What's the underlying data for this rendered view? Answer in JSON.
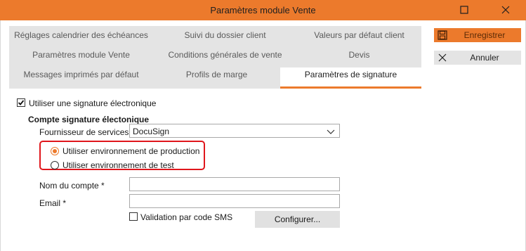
{
  "window": {
    "title": "Paramètres module Vente"
  },
  "tabs": [
    {
      "label": "Réglages calendrier des échéances"
    },
    {
      "label": "Suivi du dossier client"
    },
    {
      "label": "Valeurs par défaut client"
    },
    {
      "label": "Paramètres module Vente"
    },
    {
      "label": "Conditions générales de vente"
    },
    {
      "label": "Devis"
    },
    {
      "label": "Messages imprimés par défaut"
    },
    {
      "label": "Profils de marge"
    },
    {
      "label": "Paramètres de signature",
      "active": true
    }
  ],
  "actions": {
    "save_label": "Enregistrer",
    "cancel_label": "Annuler"
  },
  "signature": {
    "use_esign_label": "Utiliser une signature électronique",
    "use_esign_checked": true,
    "account_section_title": "Compte signature électonique",
    "provider_label": "Fournisseur de services :",
    "provider_value": "DocuSign",
    "env_production_label": "Utiliser environnement de production",
    "env_test_label": "Utiliser environnement de test",
    "env_selected": "production",
    "account_name_label": "Nom du compte *",
    "account_name_value": "",
    "email_label": "Email *",
    "email_value": "",
    "sms_validation_label": "Validation par code SMS",
    "sms_validation_checked": false,
    "configure_label": "Configurer..."
  },
  "colors": {
    "accent": "#ec7a2c",
    "highlight": "#e0161c",
    "tab_bg": "#e4e4e4"
  },
  "icons": {
    "save": "floppy-disk-icon",
    "cancel": "x-icon",
    "maximize": "maximize-icon",
    "close": "close-icon",
    "dropdown": "chevron-down-icon"
  }
}
